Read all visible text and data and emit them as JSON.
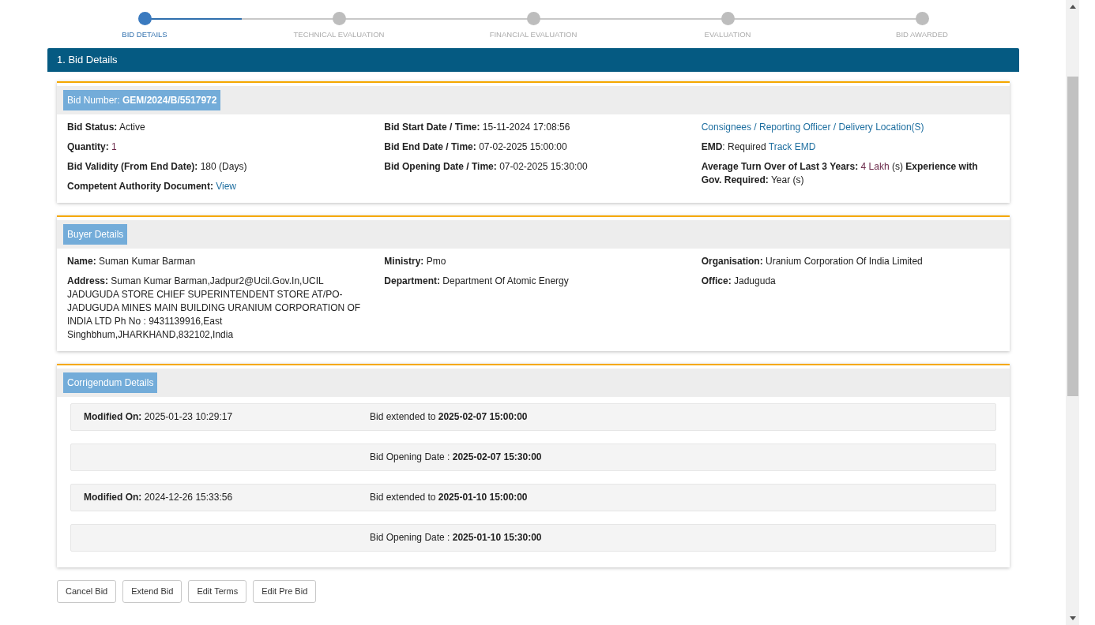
{
  "stepper": [
    {
      "label": "BID DETAILS",
      "selected": true
    },
    {
      "label": "TECHNICAL EVALUATION",
      "selected": false
    },
    {
      "label": "FINANCIAL EVALUATION",
      "selected": false
    },
    {
      "label": "EVALUATION",
      "selected": false
    },
    {
      "label": "BID AWARDED",
      "selected": false
    }
  ],
  "section_title": "1. Bid Details",
  "bid_card": {
    "header": [
      {
        "kind": "plain",
        "text": "Bid Number: "
      },
      {
        "kind": "bold",
        "text": "GEM/2024/B/5517972"
      }
    ],
    "columns": [
      [
        [
          {
            "kind": "label",
            "text": "Bid Status:"
          },
          {
            "kind": "value",
            "text": " Active"
          }
        ],
        [
          {
            "kind": "label",
            "text": "Quantity:"
          },
          {
            "kind": "accent",
            "text": " 1"
          }
        ],
        [
          {
            "kind": "label",
            "text": "Bid Validity (From End Date):"
          },
          {
            "kind": "value",
            "text": " 180 (Days)"
          }
        ],
        [
          {
            "kind": "label",
            "text": "Competent Authority Document:"
          },
          {
            "kind": "value",
            "text": " "
          },
          {
            "kind": "link",
            "text": "View"
          }
        ]
      ],
      [
        [
          {
            "kind": "label",
            "text": "Bid Start Date / Time:"
          },
          {
            "kind": "value",
            "text": " 15-11-2024 17:08:56"
          }
        ],
        [
          {
            "kind": "label",
            "text": "Bid End Date / Time:"
          },
          {
            "kind": "value",
            "text": " 07-02-2025 15:00:00"
          }
        ],
        [
          {
            "kind": "label",
            "text": "Bid Opening Date / Time:"
          },
          {
            "kind": "value",
            "text": " 07-02-2025 15:30:00"
          }
        ]
      ],
      [
        [
          {
            "kind": "link",
            "text": "Consignees / Reporting Officer / Delivery Location(S)"
          }
        ],
        [
          {
            "kind": "label",
            "text": "EMD"
          },
          {
            "kind": "value",
            "text": ": Required "
          },
          {
            "kind": "link",
            "text": "Track EMD"
          }
        ],
        [
          {
            "kind": "label",
            "text": "Average Turn Over of Last 3 Years:"
          },
          {
            "kind": "value",
            "text": " "
          },
          {
            "kind": "accent",
            "text": "4 Lakh"
          },
          {
            "kind": "value",
            "text": " (s) "
          },
          {
            "kind": "label",
            "text": "Experience with Gov. Required:"
          },
          {
            "kind": "value",
            "text": " Year (s)"
          }
        ]
      ]
    ]
  },
  "buyer_card": {
    "header": [
      {
        "kind": "plain",
        "text": "Buyer Details"
      }
    ],
    "columns": [
      [
        [
          {
            "kind": "label",
            "text": "Name:"
          },
          {
            "kind": "value",
            "text": " Suman Kumar Barman"
          }
        ],
        [
          {
            "kind": "label",
            "text": "Address:"
          },
          {
            "kind": "value",
            "text": " Suman Kumar Barman,Jadpur2@Ucil.Gov.In,UCIL JADUGUDA STORE CHIEF SUPERINTENDENT STORE AT/PO-JADUGUDA MINES MAIN BUILDING URANIUM CORPORATION OF INDIA LTD Ph No : 9431139916,East Singhbhum,JHARKHAND,832102,India"
          }
        ]
      ],
      [
        [
          {
            "kind": "label",
            "text": "Ministry:"
          },
          {
            "kind": "value",
            "text": " Pmo"
          }
        ],
        [
          {
            "kind": "label",
            "text": "Department:"
          },
          {
            "kind": "value",
            "text": " Department Of Atomic Energy"
          }
        ]
      ],
      [
        [
          {
            "kind": "label",
            "text": "Organisation:"
          },
          {
            "kind": "value",
            "text": " Uranium Corporation Of India Limited"
          }
        ],
        [
          {
            "kind": "label",
            "text": "Office:"
          },
          {
            "kind": "value",
            "text": " Jaduguda"
          }
        ]
      ]
    ]
  },
  "corrigendum": {
    "header": "Corrigendum Details",
    "rows": [
      {
        "modified": [
          {
            "kind": "label",
            "text": "Modified On:"
          },
          {
            "kind": "value",
            "text": " 2025-01-23 10:29:17"
          }
        ],
        "change": [
          {
            "kind": "value",
            "text": "Bid extended to "
          },
          {
            "kind": "label",
            "text": "2025-02-07 15:00:00"
          }
        ]
      },
      {
        "change": [
          {
            "kind": "value",
            "text": "Bid Opening Date : "
          },
          {
            "kind": "label",
            "text": "2025-02-07 15:30:00"
          }
        ]
      },
      {
        "modified": [
          {
            "kind": "label",
            "text": "Modified On:"
          },
          {
            "kind": "value",
            "text": " 2024-12-26 15:33:56"
          }
        ],
        "change": [
          {
            "kind": "value",
            "text": "Bid extended to "
          },
          {
            "kind": "label",
            "text": "2025-01-10 15:00:00"
          }
        ]
      },
      {
        "change": [
          {
            "kind": "value",
            "text": "Bid Opening Date : "
          },
          {
            "kind": "label",
            "text": "2025-01-10 15:30:00"
          }
        ]
      }
    ]
  },
  "buttons": [
    "Cancel Bid",
    "Extend Bid",
    "Edit Terms",
    "Edit Pre Bid"
  ]
}
